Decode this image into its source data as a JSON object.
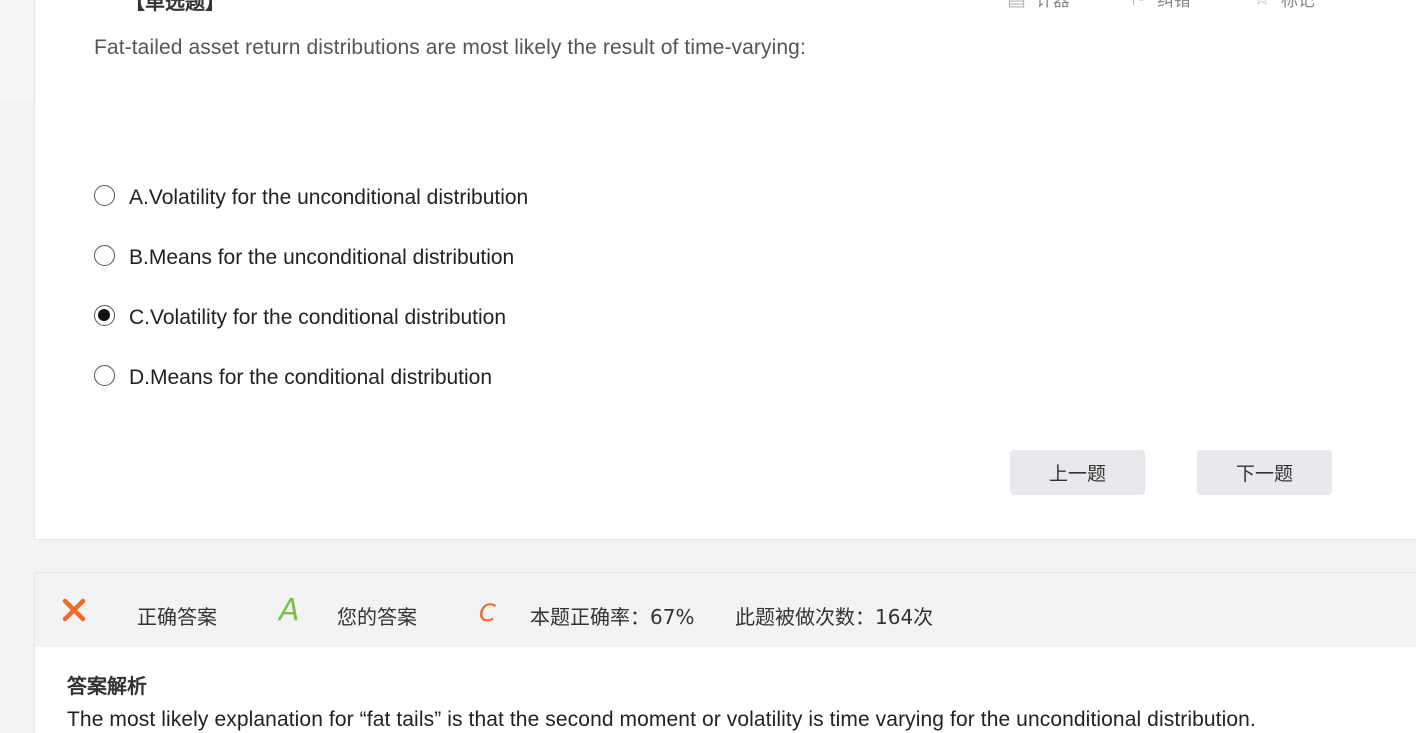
{
  "header": {
    "question_type": "【单选题】",
    "tools": [
      {
        "icon": "calculator-icon",
        "label": "计器"
      },
      {
        "icon": "report-icon",
        "label": "纠错"
      },
      {
        "icon": "star-icon",
        "label": "标记"
      }
    ]
  },
  "question": {
    "text": "Fat-tailed asset return distributions are most likely the result of time-varying:",
    "options": [
      {
        "label": "A.Volatility for the unconditional distribution",
        "checked": false
      },
      {
        "label": "B.Means for the unconditional distribution",
        "checked": false
      },
      {
        "label": "C.Volatility for the conditional distribution",
        "checked": true
      },
      {
        "label": "D.Means for the conditional distribution",
        "checked": false
      }
    ]
  },
  "nav": {
    "prev_label": "上一题",
    "next_label": "下一题"
  },
  "result": {
    "status_icon": "wrong-icon",
    "correct_answer_label": "正确答案",
    "correct_answer": "A",
    "your_answer_label": "您的答案",
    "your_answer": "C",
    "accuracy_text": "本题正确率：67%",
    "times_done_text": "此题被做次数：164次"
  },
  "analysis": {
    "title": "答案解析",
    "text": "The most likely explanation for “fat tails” is that the second moment or volatility is time varying for the unconditional distribution."
  },
  "colors": {
    "wrong": "#f06a2d",
    "correct_letter": "#7cc04a",
    "your_letter": "#f06a2d",
    "button_bg": "#e8e9ec"
  }
}
